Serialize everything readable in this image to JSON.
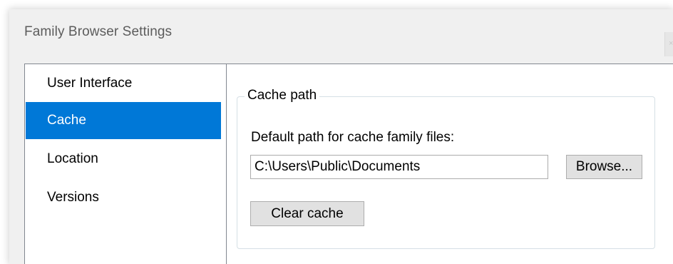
{
  "window": {
    "title": "Family Browser Settings",
    "close_symbol": "×"
  },
  "categories": [
    {
      "label": "User Interface",
      "selected": false
    },
    {
      "label": "Cache",
      "selected": true
    },
    {
      "label": "Location",
      "selected": false
    },
    {
      "label": "Versions",
      "selected": false
    }
  ],
  "cache_panel": {
    "group_title": "Cache path",
    "field_label": "Default path for cache family files:",
    "path_value": "C:\\Users\\Public\\Documents",
    "browse_label": "Browse...",
    "clear_label": "Clear cache"
  },
  "colors": {
    "selection": "#0078d7",
    "window_background": "#f0f0f0",
    "button_background": "#e1e1e1"
  },
  "icons": {
    "close": "close-icon"
  }
}
